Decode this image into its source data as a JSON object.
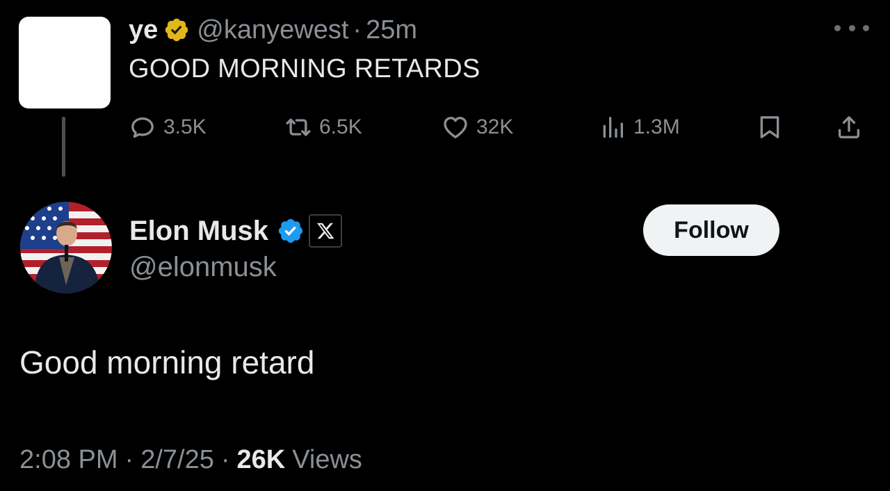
{
  "parent_tweet": {
    "author_name": "ye",
    "handle": "@kanyewest",
    "separator": "·",
    "time_ago": "25m",
    "text": "GOOD MORNING RETARDS",
    "actions": {
      "replies": "3.5K",
      "reposts": "6.5K",
      "likes": "32K",
      "views": "1.3M"
    },
    "badge_color": "#e2b719"
  },
  "reply_tweet": {
    "author_name": "Elon Musk",
    "handle": "@elonmusk",
    "follow_label": "Follow",
    "text": "Good morning retard",
    "time": "2:08 PM",
    "separator": "·",
    "date": "2/7/25",
    "views_count": "26K",
    "views_label": "Views",
    "badge_color": "#1d9bf0"
  },
  "icons": {
    "more": "more-horizontal-icon",
    "reply": "reply-icon",
    "repost": "repost-icon",
    "like": "heart-icon",
    "views": "views-chart-icon",
    "bookmark": "bookmark-icon",
    "share": "share-icon",
    "verified_gold": "gold-verified-badge-icon",
    "verified_blue": "blue-verified-badge-icon",
    "affiliate": "x-logo-icon"
  }
}
